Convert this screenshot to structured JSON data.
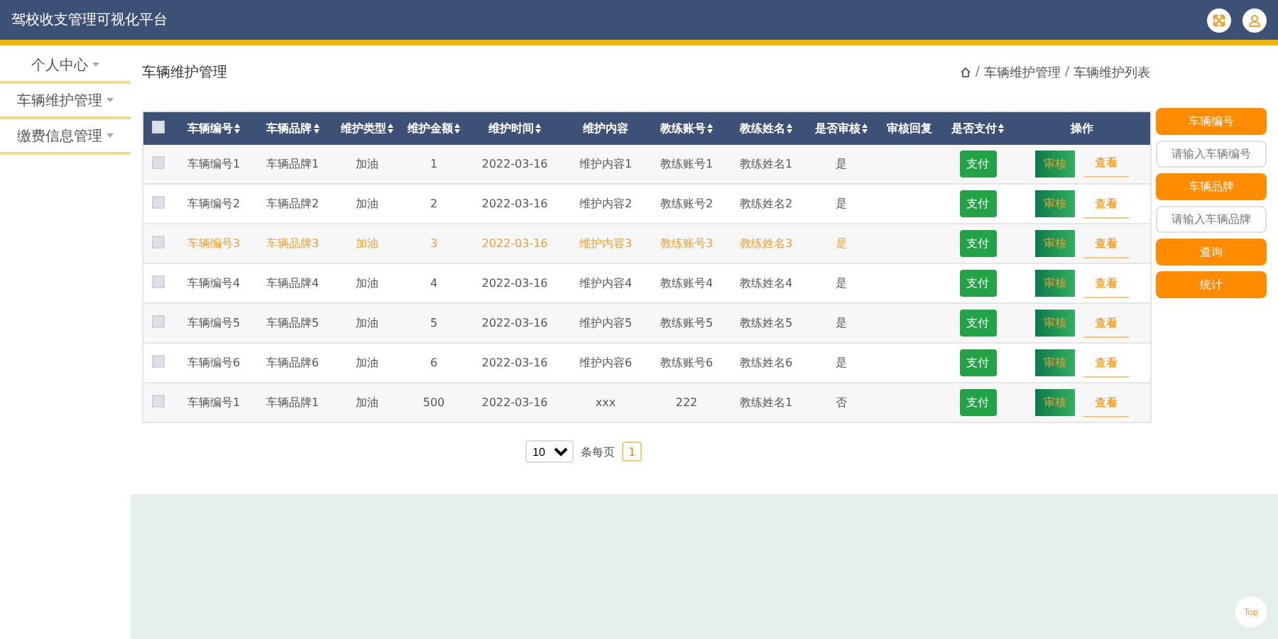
{
  "header": {
    "title": "驾校收支管理可视化平台"
  },
  "sidebar": {
    "items": [
      {
        "label": "个人中心"
      },
      {
        "label": "车辆维护管理"
      },
      {
        "label": "缴费信息管理"
      }
    ]
  },
  "page_title": "车辆维护管理",
  "breadcrumb": [
    {
      "kind": "separator",
      "text": "/"
    },
    {
      "kind": "link",
      "text": "车辆维护管理"
    },
    {
      "kind": "separator",
      "text": "/"
    },
    {
      "kind": "link",
      "text": "车辆维护列表"
    }
  ],
  "table": {
    "select_all": {
      "checked": false
    },
    "columns": [
      {
        "kind": "text",
        "label": "车辆编号",
        "sortable": true
      },
      {
        "kind": "text",
        "label": "车辆品牌",
        "sortable": true
      },
      {
        "kind": "text",
        "label": "维护类型",
        "sortable": true
      },
      {
        "kind": "text",
        "label": "维护金额",
        "sortable": true
      },
      {
        "kind": "text",
        "label": "维护时间",
        "sortable": true
      },
      {
        "kind": "text",
        "label": "维护内容",
        "sortable": false
      },
      {
        "kind": "text",
        "label": "教练账号",
        "sortable": true
      },
      {
        "kind": "text",
        "label": "教练姓名",
        "sortable": true
      },
      {
        "kind": "text",
        "label": "是否审核",
        "sortable": true
      },
      {
        "kind": "text",
        "label": "审核回复",
        "sortable": false
      },
      {
        "kind": "pay",
        "label": "是否支付",
        "sortable": true
      },
      {
        "kind": "actions",
        "label": "操作",
        "sortable": false
      }
    ],
    "rows": [
      {
        "selected": false,
        "checked": false,
        "cells": [
          "车辆编号1",
          "车辆品牌1",
          "加油",
          "1",
          "2022-03-16",
          "维护内容1",
          "教练账号1",
          "教练姓名1",
          "是",
          null,
          "支付",
          [
            "审核",
            "查看"
          ]
        ]
      },
      {
        "selected": false,
        "checked": false,
        "cells": [
          "车辆编号2",
          "车辆品牌2",
          "加油",
          "2",
          "2022-03-16",
          "维护内容2",
          "教练账号2",
          "教练姓名2",
          "是",
          null,
          "支付",
          [
            "审核",
            "查看"
          ]
        ]
      },
      {
        "selected": true,
        "checked": false,
        "cells": [
          "车辆编号3",
          "车辆品牌3",
          "加油",
          "3",
          "2022-03-16",
          "维护内容3",
          "教练账号3",
          "教练姓名3",
          "是",
          null,
          "支付",
          [
            "审核",
            "查看"
          ]
        ]
      },
      {
        "selected": false,
        "checked": false,
        "cells": [
          "车辆编号4",
          "车辆品牌4",
          "加油",
          "4",
          "2022-03-16",
          "维护内容4",
          "教练账号4",
          "教练姓名4",
          "是",
          null,
          "支付",
          [
            "审核",
            "查看"
          ]
        ]
      },
      {
        "selected": false,
        "checked": false,
        "cells": [
          "车辆编号5",
          "车辆品牌5",
          "加油",
          "5",
          "2022-03-16",
          "维护内容5",
          "教练账号5",
          "教练姓名5",
          "是",
          null,
          "支付",
          [
            "审核",
            "查看"
          ]
        ]
      },
      {
        "selected": false,
        "checked": false,
        "cells": [
          "车辆编号6",
          "车辆品牌6",
          "加油",
          "6",
          "2022-03-16",
          "维护内容6",
          "教练账号6",
          "教练姓名6",
          "是",
          null,
          "支付",
          [
            "审核",
            "查看"
          ]
        ]
      },
      {
        "selected": false,
        "checked": false,
        "cells": [
          "车辆编号1",
          "车辆品牌1",
          "加油",
          "500",
          "2022-03-16",
          "xxx",
          "222",
          "教练姓名1",
          "否",
          null,
          "支付",
          [
            "审核",
            "查看"
          ]
        ]
      }
    ]
  },
  "search": [
    {
      "kind": "label",
      "text": "车辆编号"
    },
    {
      "kind": "input",
      "placeholder": "请输入车辆编号"
    },
    {
      "kind": "label",
      "text": "车辆品牌"
    },
    {
      "kind": "input",
      "placeholder": "请输入车辆品牌"
    },
    {
      "kind": "button",
      "text": "查询"
    },
    {
      "kind": "button",
      "text": "统计"
    }
  ],
  "pagination": {
    "page_size": "10",
    "suffix": "条每页",
    "pages": [
      {
        "label": "1",
        "selected": true
      }
    ]
  },
  "top_button": "Top"
}
